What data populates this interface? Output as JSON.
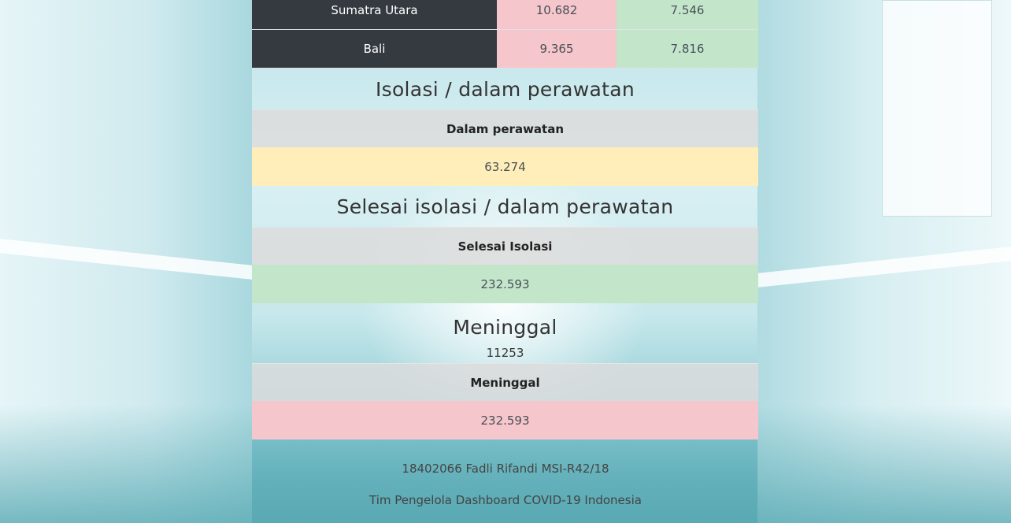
{
  "provinces": [
    {
      "name": "Sumatra Utara",
      "positif": "10.682",
      "sembuh": "7.546"
    },
    {
      "name": "Bali",
      "positif": "9.365",
      "sembuh": "7.816"
    }
  ],
  "isolasi": {
    "title": "Isolasi / dalam perawatan",
    "header": "Dalam perawatan",
    "value": "63.274"
  },
  "selesai": {
    "title": "Selesai isolasi / dalam perawatan",
    "header": "Selesai Isolasi",
    "value": "232.593"
  },
  "meninggal": {
    "title": "Meninggal",
    "count": "11253",
    "header": "Meninggal",
    "value": "232.593"
  },
  "footer": {
    "author": "18402066 Fadli Rifandi MSI-R42/18",
    "team": "Tim Pengelola Dashboard COVID-19 Indonesia"
  },
  "colors": {
    "dark_cell": "#343a40",
    "danger_light": "#f5c6cb",
    "success_light": "#c3e6cb",
    "warning_light": "#ffeeba",
    "header_gray": "#dcdcdc"
  }
}
